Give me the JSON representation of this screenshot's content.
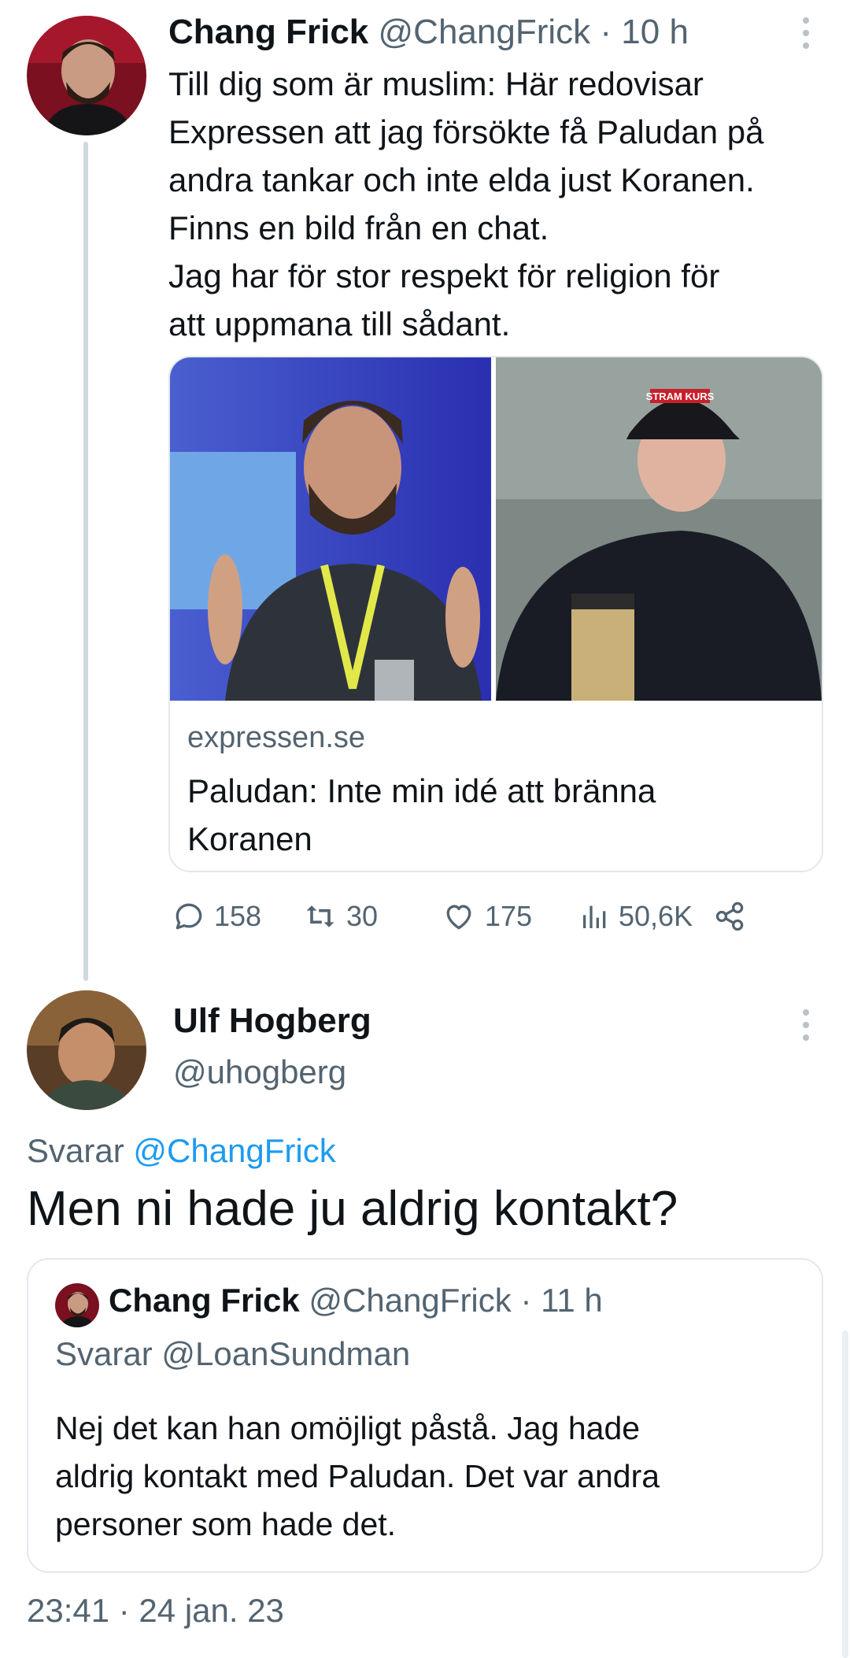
{
  "tweet": {
    "author_name": "Chang Frick",
    "author_handle": "@ChangFrick",
    "separator": "·",
    "time": "10 h",
    "text_lines": [
      "Till dig som är muslim: Här redovisar",
      "Expressen att jag försökte få Paludan på",
      "andra tankar och inte elda just Koranen.",
      "Finns en bild från en chat.",
      "Jag har för stor respekt för religion för",
      "att uppmana till sådant."
    ],
    "link_card": {
      "domain": "expressen.se",
      "title_lines": [
        "Paludan: Inte min idé att bränna",
        "Koranen"
      ],
      "cap_text": "STRAM KURS"
    },
    "actions": {
      "replies": "158",
      "retweets": "30",
      "likes": "175",
      "views": "50,6K"
    }
  },
  "reply": {
    "author_name": "Ulf Hogberg",
    "author_handle": "@uhogberg",
    "replying_prefix": "Svarar",
    "replying_to": "@ChangFrick",
    "text": "Men ni hade ju aldrig kontakt?",
    "timestamp": "23:41 · 24 jan. 23"
  },
  "quoted_tweet": {
    "author_name": "Chang Frick",
    "author_handle": "@ChangFrick",
    "separator": "·",
    "time": "11 h",
    "replying_to_text": "Svarar @LoanSundman",
    "text_lines": [
      "Nej det kan han omöjligt påstå. Jag hade",
      "aldrig kontakt med Paludan. Det var andra",
      "personer som hade det."
    ]
  },
  "colors": {
    "text_primary": "#0f1419",
    "text_secondary": "#536471",
    "link": "#1d9bf0",
    "border": "#e3e8eb",
    "thread_line": "#cfd9de"
  },
  "icons": {
    "reply": "speech-bubble-icon",
    "retweet": "retweet-icon",
    "like": "heart-icon",
    "views": "bar-chart-icon",
    "share": "share-icon",
    "more": "vertical-dots-icon"
  }
}
